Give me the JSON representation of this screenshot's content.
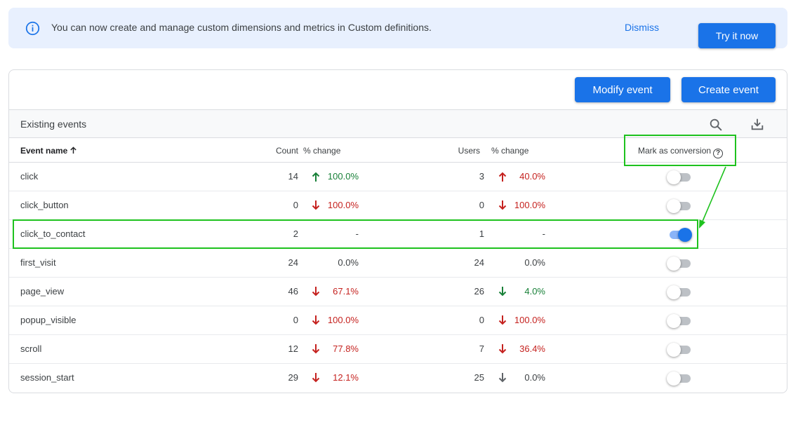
{
  "banner": {
    "message": "You can now create and manage custom dimensions and metrics in Custom definitions.",
    "dismiss_label": "Dismiss",
    "try_label": "Try it now",
    "icon": "info-icon"
  },
  "toolbar": {
    "modify_label": "Modify event",
    "create_label": "Create event"
  },
  "section": {
    "title": "Existing events",
    "icons": [
      "search-icon",
      "download-icon"
    ]
  },
  "columns": {
    "name": "Event name",
    "count": "Count",
    "count_change": "% change",
    "users": "Users",
    "users_change": "% change",
    "mark": "Mark as conversion",
    "help": "?"
  },
  "colors": {
    "accent": "#1a73e8",
    "up": "#188038",
    "down": "#c5221f",
    "highlight": "#1ec21e"
  },
  "events": [
    {
      "name": "click",
      "count": "14",
      "count_dir": "up",
      "count_change": "100.0%",
      "users": "3",
      "users_dir": "up-red",
      "users_change": "40.0%",
      "conversion": false
    },
    {
      "name": "click_button",
      "count": "0",
      "count_dir": "down",
      "count_change": "100.0%",
      "users": "0",
      "users_dir": "down",
      "users_change": "100.0%",
      "conversion": false
    },
    {
      "name": "click_to_contact",
      "count": "2",
      "count_dir": "none",
      "count_change": "-",
      "users": "1",
      "users_dir": "none",
      "users_change": "-",
      "conversion": true
    },
    {
      "name": "first_visit",
      "count": "24",
      "count_dir": "none",
      "count_change": "0.0%",
      "users": "24",
      "users_dir": "none",
      "users_change": "0.0%",
      "conversion": false
    },
    {
      "name": "page_view",
      "count": "46",
      "count_dir": "down",
      "count_change": "67.1%",
      "users": "26",
      "users_dir": "down-green",
      "users_change": "4.0%",
      "conversion": false
    },
    {
      "name": "popup_visible",
      "count": "0",
      "count_dir": "down",
      "count_change": "100.0%",
      "users": "0",
      "users_dir": "down",
      "users_change": "100.0%",
      "conversion": false
    },
    {
      "name": "scroll",
      "count": "12",
      "count_dir": "down",
      "count_change": "77.8%",
      "users": "7",
      "users_dir": "down",
      "users_change": "36.4%",
      "conversion": false
    },
    {
      "name": "session_start",
      "count": "29",
      "count_dir": "down",
      "count_change": "12.1%",
      "users": "25",
      "users_dir": "down-gray",
      "users_change": "0.0%",
      "conversion": false
    }
  ]
}
